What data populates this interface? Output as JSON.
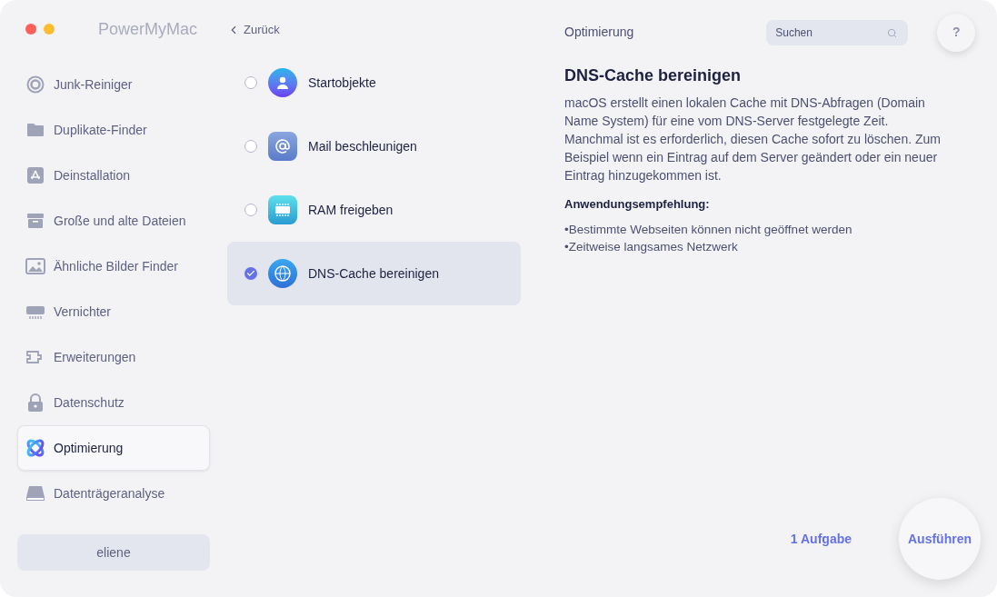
{
  "window": {
    "title": "PowerMyMac"
  },
  "back": {
    "label": "Zurück"
  },
  "sidebar": {
    "items": [
      {
        "label": "Junk-Reiniger",
        "selected": false
      },
      {
        "label": "Duplikate-Finder",
        "selected": false
      },
      {
        "label": "Deinstallation",
        "selected": false
      },
      {
        "label": "Große und alte Dateien",
        "selected": false
      },
      {
        "label": "Ähnliche Bilder Finder",
        "selected": false
      },
      {
        "label": "Vernichter",
        "selected": false
      },
      {
        "label": "Erweiterungen",
        "selected": false
      },
      {
        "label": "Datenschutz",
        "selected": false
      },
      {
        "label": "Optimierung",
        "selected": true
      },
      {
        "label": "Datenträgeranalyse",
        "selected": false
      }
    ],
    "user": "eliene"
  },
  "tasks": [
    {
      "label": "Startobjekte",
      "checked": false,
      "selected": false
    },
    {
      "label": "Mail beschleunigen",
      "checked": false,
      "selected": false
    },
    {
      "label": "RAM freigeben",
      "checked": false,
      "selected": false
    },
    {
      "label": "DNS-Cache bereinigen",
      "checked": true,
      "selected": true
    }
  ],
  "header": {
    "section": "Optimierung",
    "search": {
      "placeholder": "Suchen"
    },
    "help": "?"
  },
  "detail": {
    "title": "DNS-Cache bereinigen",
    "description": "macOS erstellt einen lokalen Cache mit DNS-Abfragen (Domain Name System) für eine vom DNS-Server festgelegte Zeit. Manchmal ist es erforderlich, diesen Cache sofort zu löschen. Zum Beispiel wenn ein Eintrag auf dem Server geändert oder ein neuer Eintrag hinzugekommen ist.",
    "recommendation_title": "Anwendungsempfehlung:",
    "recommendations": [
      "•Bestimmte Webseiten können nicht geöffnet werden",
      "•Zeitweise langsames Netzwerk"
    ]
  },
  "footer": {
    "count": "1 Aufgabe",
    "run": "Ausführen"
  }
}
